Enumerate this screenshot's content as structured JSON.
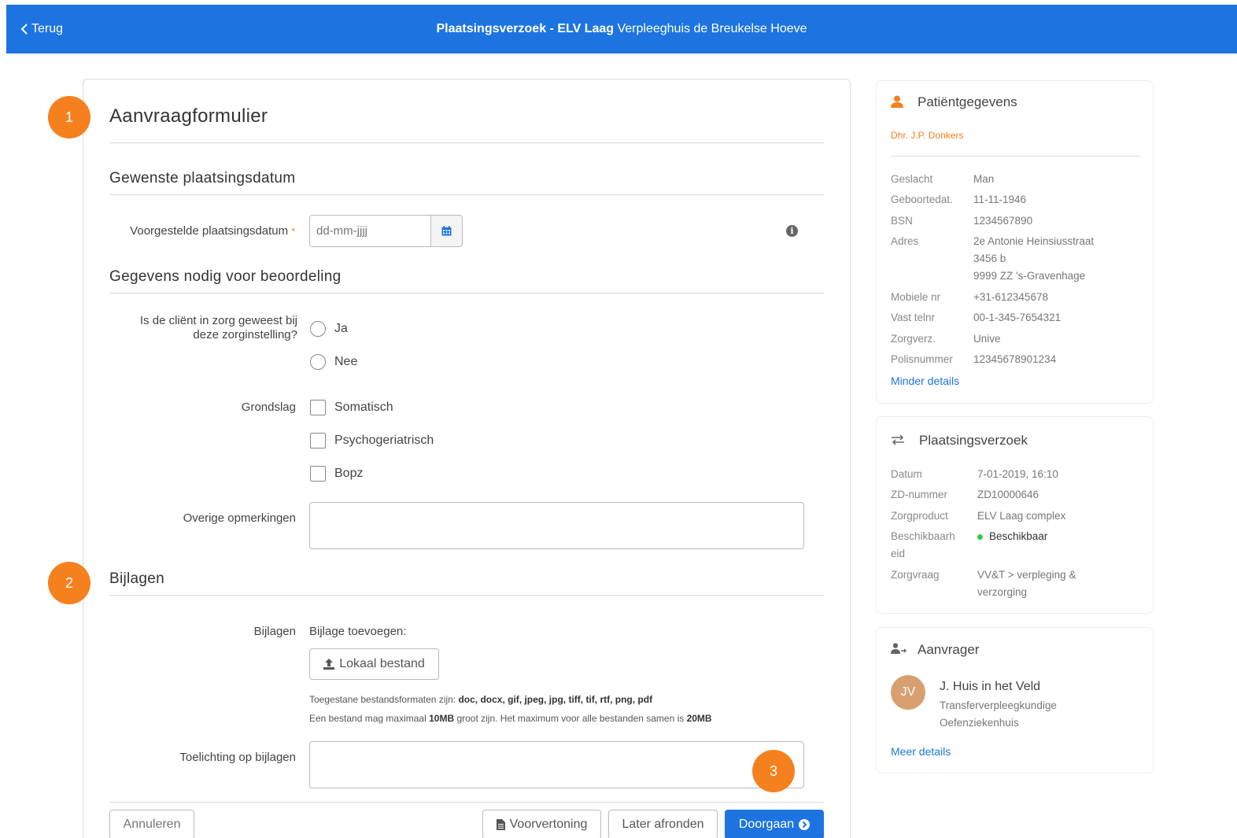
{
  "topbar": {
    "back_label": "Terug",
    "title_bold": "Plaatsingsverzoek - ELV Laag",
    "title_rest": " Verpleeghuis de Breukelse Hoeve"
  },
  "badges": [
    "1",
    "2",
    "3"
  ],
  "form": {
    "title": "Aanvraagformulier",
    "section_date": "Gewenste plaatsingsdatum",
    "date_label": "Voorgestelde plaatsingsdatum",
    "required_mark": "*",
    "date_placeholder": "dd-mm-jjjj",
    "section_assessment": "Gegevens nodig voor beoordeling",
    "care_question_line1": "Is de cliënt in zorg geweest bij",
    "care_question_line2": "deze zorginstelling?",
    "radio_yes": "Ja",
    "radio_no": "Nee",
    "basis_label": "Grondslag",
    "basis_options": [
      "Somatisch",
      "Psychogeriatrisch",
      "Bopz"
    ],
    "remarks_label": "Overige opmerkingen",
    "section_attachments": "Bijlagen",
    "attachments_label": "Bijlagen",
    "add_attachment": "Bijlage toevoegen:",
    "local_file_button": "Lokaal bestand",
    "formats_prefix": "Toegestane bestandsformaten zijn: ",
    "formats_list": "doc, docx, gif, jpeg, jpg, tiff, tif, rtf, png, pdf",
    "size_prefix": "Een bestand mag maximaal ",
    "size_single": "10MB",
    "size_mid": " groot zijn. Het maximum voor alle bestanden samen is ",
    "size_total": "20MB",
    "attachment_note_label": "Toelichting op bijlagen",
    "buttons": {
      "cancel": "Annuleren",
      "preview": "Voorvertoning",
      "later": "Later afronden",
      "continue": "Doorgaan"
    }
  },
  "patient": {
    "title": "Patiëntgegevens",
    "name": "Dhr. J.P. Donkers",
    "fields": [
      {
        "k": "Geslacht",
        "v": "Man"
      },
      {
        "k": "Geboortedat.",
        "v": "11-11-1946"
      },
      {
        "k": "BSN",
        "v": "1234567890"
      },
      {
        "k": "Adres",
        "v1": "2e Antonie Heinsiusstraat",
        "v2": "3456 b",
        "v3": "9999 ZZ 's-Gravenhage"
      },
      {
        "k": "Mobiele nr",
        "v": "+31-612345678"
      },
      {
        "k": "Vast telnr",
        "v": "00-1-345-7654321"
      },
      {
        "k": "Zorgverz.",
        "v": "Unive"
      },
      {
        "k": "Polisnummer",
        "v": "12345678901234"
      }
    ],
    "less_details": "Minder details"
  },
  "request": {
    "title": "Plaatsingsverzoek",
    "fields": [
      {
        "k": "Datum",
        "v": "7-01-2019, 16:10"
      },
      {
        "k": "ZD-nummer",
        "v": "ZD10000646"
      },
      {
        "k": "Zorgproduct",
        "v": "ELV Laag complex"
      },
      {
        "k1": "Beschikbaarh",
        "k2": "eid",
        "v": "Beschikbaar"
      },
      {
        "k": "Zorgvraag",
        "v1": "VV&T > verpleging &",
        "v2": "verzorging"
      }
    ]
  },
  "requester": {
    "title": "Aanvrager",
    "initials": "JV",
    "name": "J. Huis in het Veld",
    "role": "Transferverpleegkundige",
    "org": "Oefenziekenhuis",
    "more_details": "Meer details"
  },
  "colors": {
    "primary": "#1d74e0",
    "accent": "#f5801e",
    "available": "#2ecc40"
  }
}
